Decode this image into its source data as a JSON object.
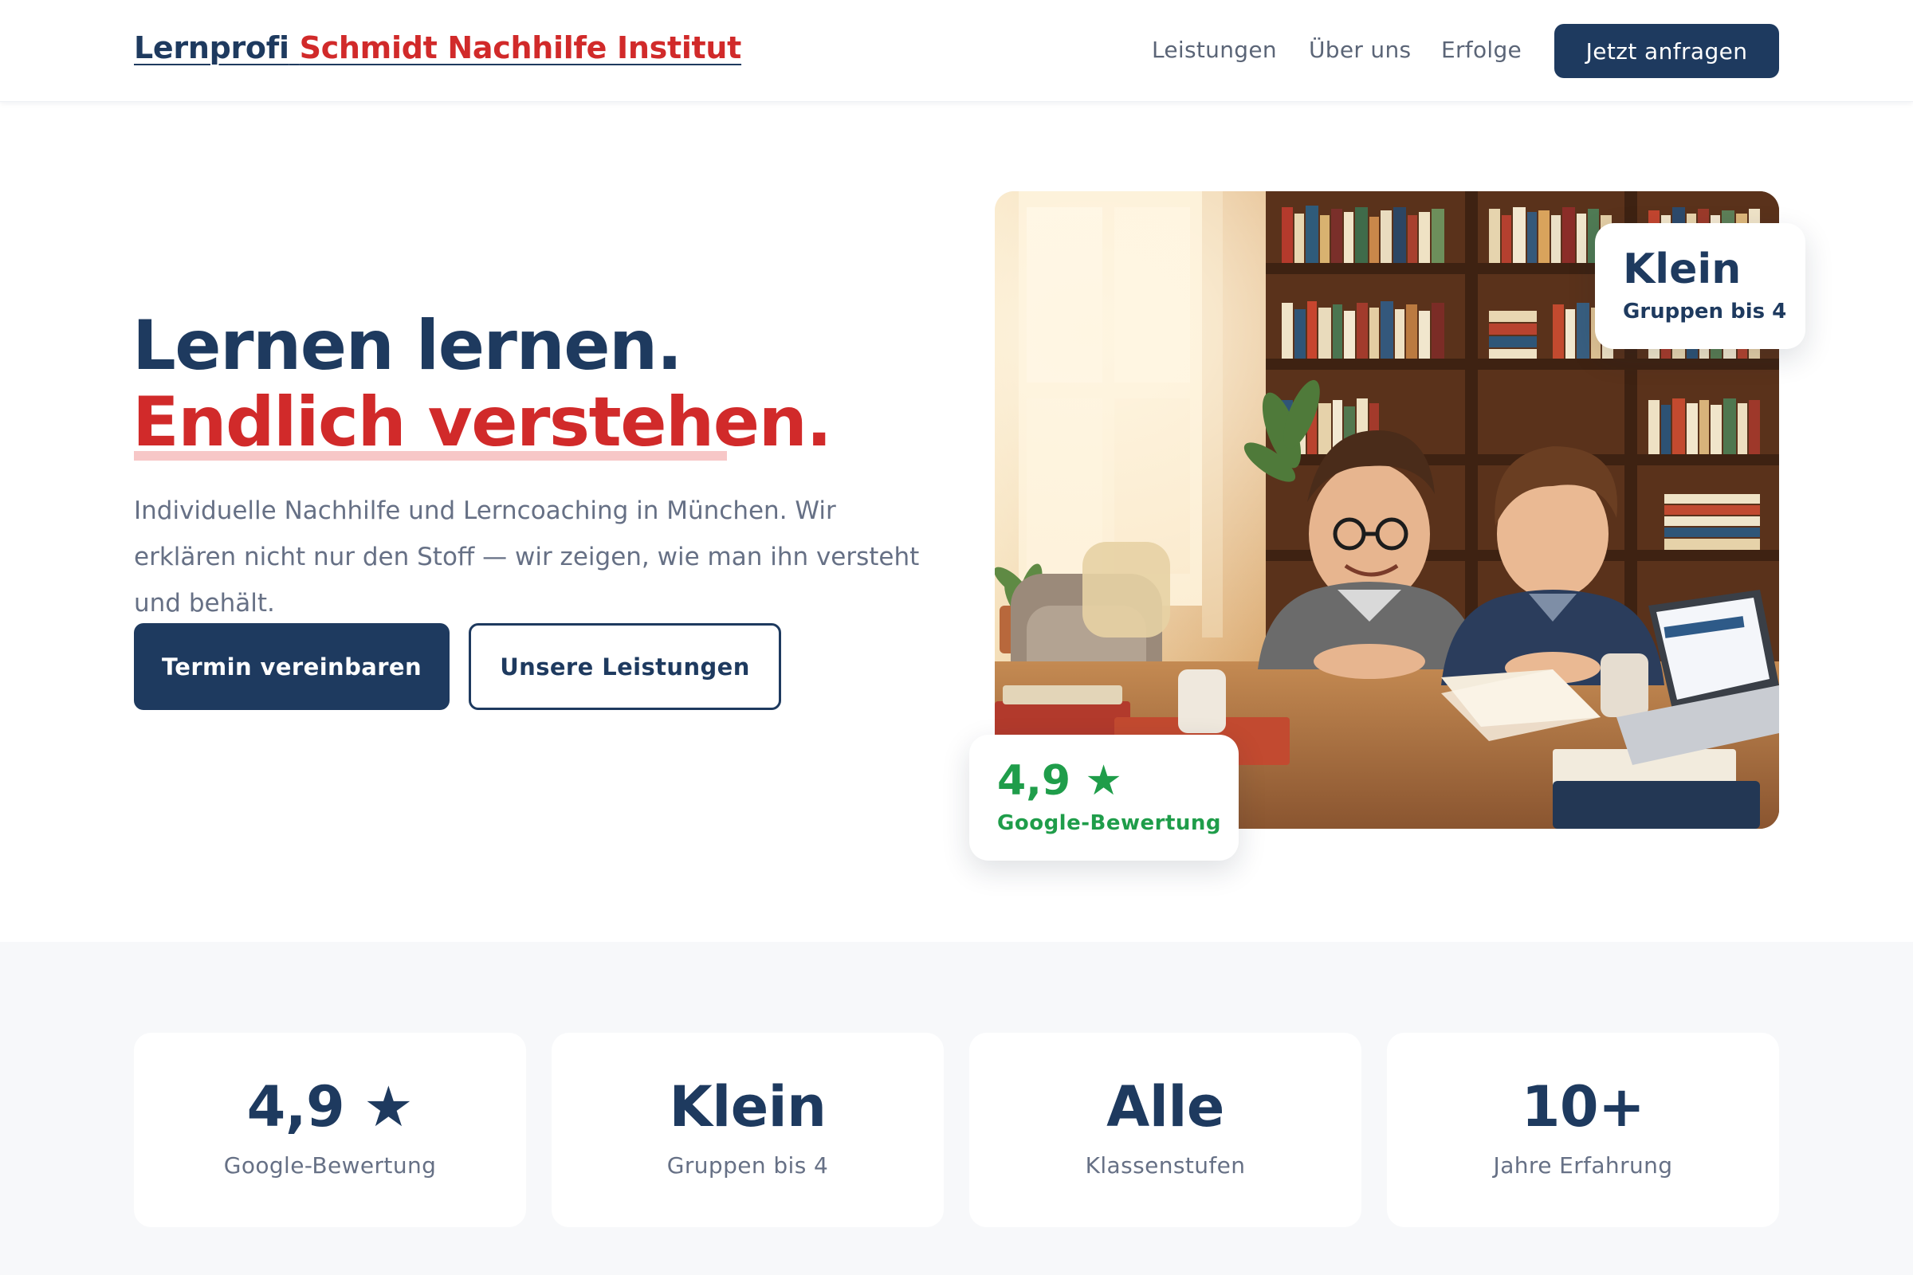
{
  "header": {
    "logo_brand": "Lernprofi",
    "logo_name": "Schmidt Nachhilfe Institut",
    "nav": [
      "Leistungen",
      "Über uns",
      "Erfolge"
    ],
    "cta_label": "Jetzt anfragen"
  },
  "hero": {
    "title_line1": "Lernen lernen.",
    "title_line2": "Endlich verstehen.",
    "description": "Individuelle Nachhilfe und Lerncoaching in München. Wir erklären nicht nur den Stoff — wir zeigen, wie man ihn versteht und behält.",
    "primary_button": "Termin vereinbaren",
    "secondary_button": "Unsere Leistungen",
    "image_icon": "photo-tutoring-scene"
  },
  "badges": {
    "group": {
      "value": "Klein",
      "label": "Gruppen bis 4"
    },
    "rating": {
      "value": "4,9 ★",
      "label": "Google-Bewertung"
    }
  },
  "stats": [
    {
      "value": "4,9 ★",
      "label": "Google-Bewertung"
    },
    {
      "value": "Klein",
      "label": "Gruppen bis 4"
    },
    {
      "value": "Alle",
      "label": "Klassenstufen"
    },
    {
      "value": "10+",
      "label": "Jahre Erfahrung"
    }
  ],
  "colors": {
    "navy": "#1e3a5f",
    "red": "#d12a2a",
    "green": "#1f9d4a",
    "muted": "#667085",
    "section_bg": "#f7f8fa"
  }
}
